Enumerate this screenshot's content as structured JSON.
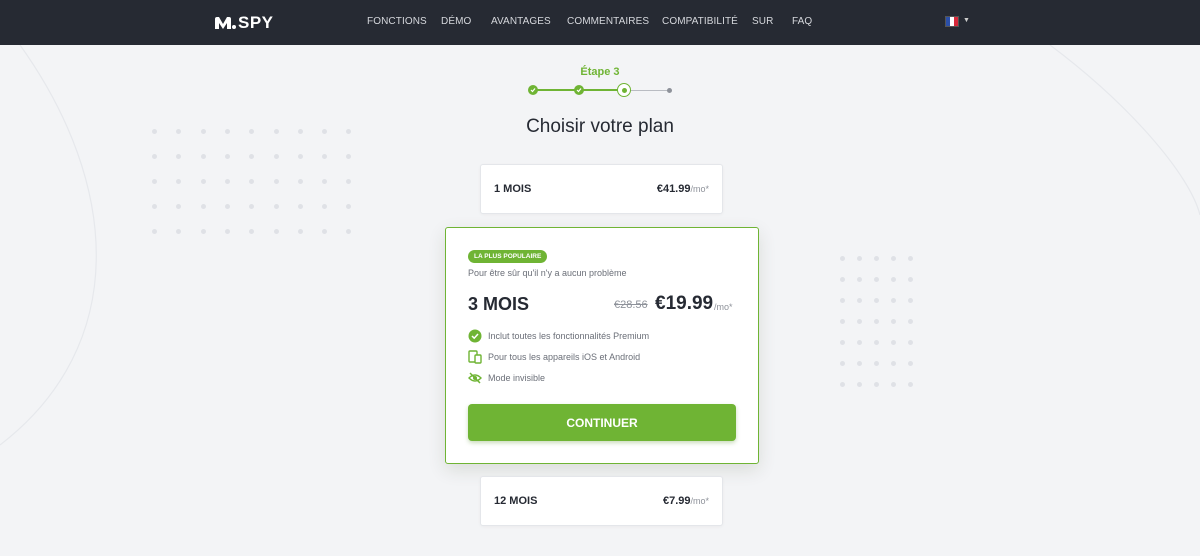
{
  "nav": {
    "logo": "SPY",
    "items": [
      "FONCTIONS",
      "DÉMO",
      "AVANTAGES",
      "COMMENTAIRES",
      "COMPATIBILITÉ",
      "SUR",
      "FAQ"
    ],
    "language_icon": "france-flag-icon",
    "colors": {
      "background": "#262a33",
      "accent": "#6fb434"
    }
  },
  "stepper": {
    "label": "Étape 3",
    "current_step": 3,
    "total_steps": 4
  },
  "page_title": "Choisir votre plan",
  "plans": {
    "one_month": {
      "name": "1 MOIS",
      "price": "€41.99",
      "unit": "/mo*"
    },
    "three_months": {
      "badge": "LA PLUS POPULAIRE",
      "subtitle": "Pour être sûr qu'il n'y a aucun problème",
      "name": "3 MOIS",
      "old_price": "€28.56",
      "price": "€19.99",
      "unit": "/mo*",
      "features": [
        {
          "icon": "check-circle-icon",
          "text": "Inclut toutes les fonctionnalités Premium"
        },
        {
          "icon": "devices-icon",
          "text": "Pour tous les appareils iOS et Android"
        },
        {
          "icon": "eye-slash-icon",
          "text": "Mode invisible"
        }
      ],
      "cta": "CONTINUER"
    },
    "twelve_months": {
      "name": "12 MOIS",
      "price": "€7.99",
      "unit": "/mo*"
    }
  }
}
